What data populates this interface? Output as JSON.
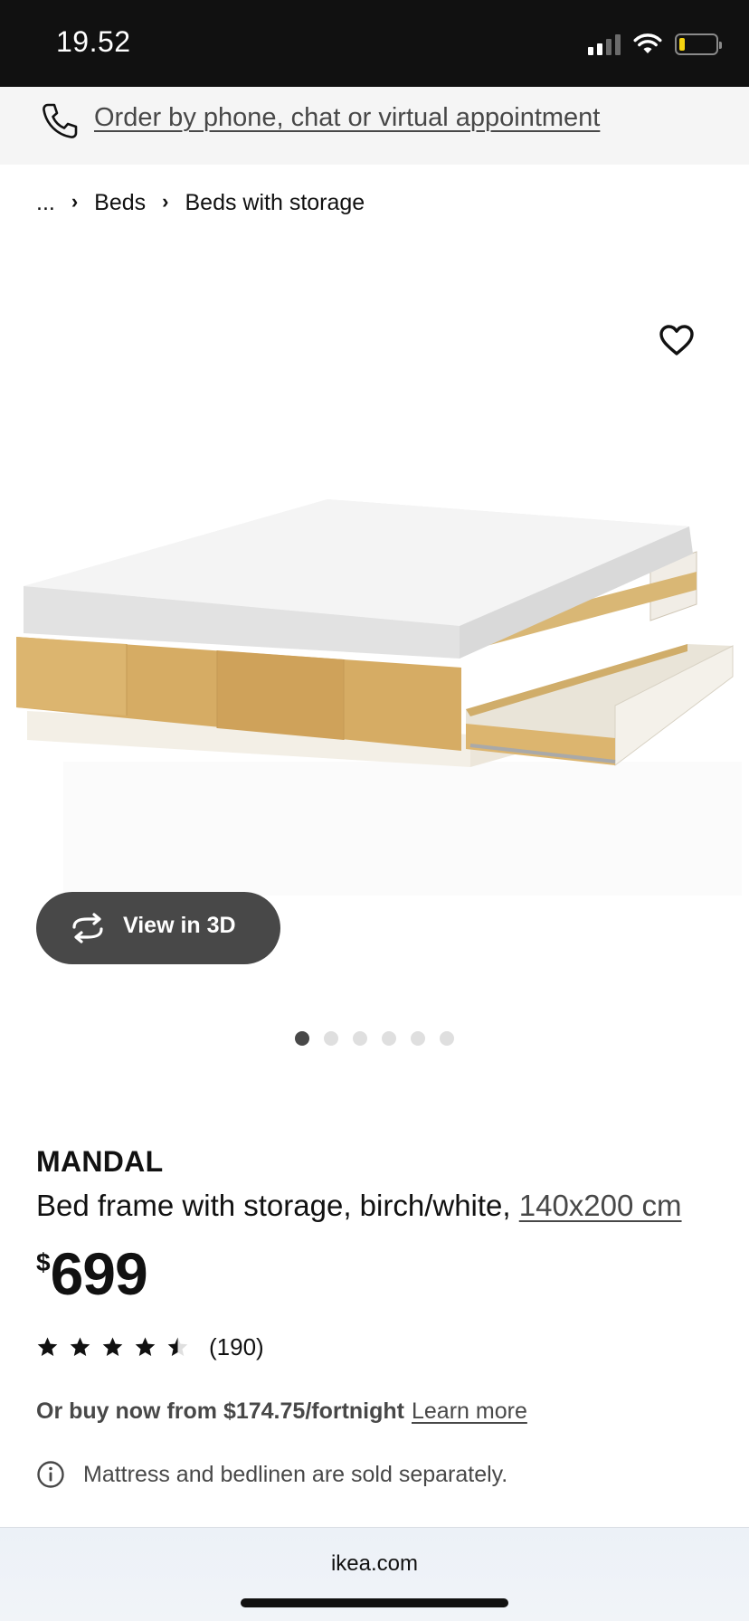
{
  "status_bar": {
    "time": "19.52",
    "signal_icon": "cellular-signal-icon",
    "wifi_icon": "wifi-icon",
    "battery_icon": "battery-low-icon",
    "battery_level": 0.15,
    "battery_color": "#f5d30f"
  },
  "order_banner": {
    "icon": "phone-icon",
    "link_text": "Order by phone, chat or virtual appointment"
  },
  "breadcrumb": {
    "items": [
      "...",
      "Beds",
      "Beds with storage"
    ],
    "separator": "›"
  },
  "gallery": {
    "image_subject": "bed-frame-with-drawer-photo",
    "wishlist_icon": "heart-outline-icon",
    "view_3d_label": "View in 3D",
    "view_3d_icon": "rotate-3d-icon",
    "total_images": 6,
    "active_index": 0
  },
  "product": {
    "name": "MANDAL",
    "description": "Bed frame with storage, birch/white, ",
    "size": "140x200 cm",
    "price_currency": "$",
    "price_amount": "699",
    "rating_value": 4.5,
    "rating_max": 5,
    "rating_count": "(190)",
    "afterpay_text": "Or buy now from $174.75/fortnight",
    "learn_more": "Learn more",
    "info_icon": "info-circle-icon",
    "info_text": "Mattress and bedlinen are sold separately."
  },
  "browser": {
    "url": "ikea.com"
  },
  "colors": {
    "text": "#111111",
    "muted": "#484848",
    "status_bar_bg": "#111111",
    "banner_bg": "#f5f5f5",
    "button_dark": "#484848",
    "dot_inactive": "#dfdfdf",
    "star_empty": "#dfdfdf"
  }
}
